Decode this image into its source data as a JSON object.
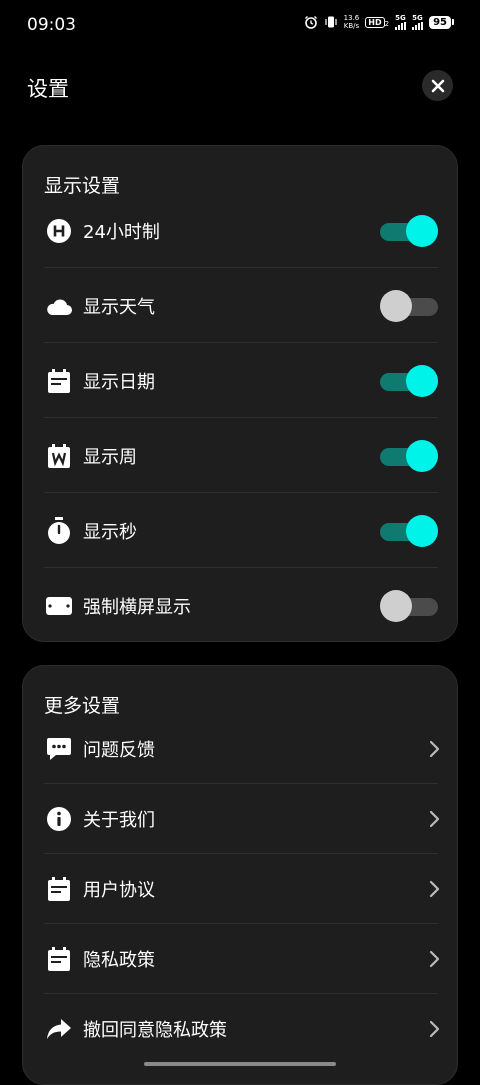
{
  "status_bar": {
    "time": "09:03",
    "net_speed_value": "13.6",
    "net_speed_unit": "KB/s",
    "hd_label": "HD",
    "hd_sub": "2",
    "sim1_label": "5G",
    "sim2_label": "5G",
    "battery": "95"
  },
  "header": {
    "title": "设置",
    "close_icon": "close-icon"
  },
  "display_settings": {
    "title": "显示设置",
    "items": [
      {
        "label": "24小时制",
        "icon": "h-circle-icon",
        "on": true
      },
      {
        "label": "显示天气",
        "icon": "cloud-icon",
        "on": false
      },
      {
        "label": "显示日期",
        "icon": "calendar-icon",
        "on": true
      },
      {
        "label": "显示周",
        "icon": "calendar-week-icon",
        "on": true
      },
      {
        "label": "显示秒",
        "icon": "stopwatch-icon",
        "on": true
      },
      {
        "label": "强制横屏显示",
        "icon": "landscape-icon",
        "on": false
      }
    ]
  },
  "more_settings": {
    "title": "更多设置",
    "items": [
      {
        "label": "问题反馈",
        "icon": "feedback-icon"
      },
      {
        "label": "关于我们",
        "icon": "info-icon"
      },
      {
        "label": "用户协议",
        "icon": "document-icon"
      },
      {
        "label": "隐私政策",
        "icon": "document-icon"
      },
      {
        "label": "撤回同意隐私政策",
        "icon": "share-arrow-icon"
      }
    ]
  },
  "colors": {
    "accent": "#00f3e8",
    "accent_track": "#0f7a70",
    "card_bg": "#1e1e1e",
    "page_bg": "#000000"
  }
}
